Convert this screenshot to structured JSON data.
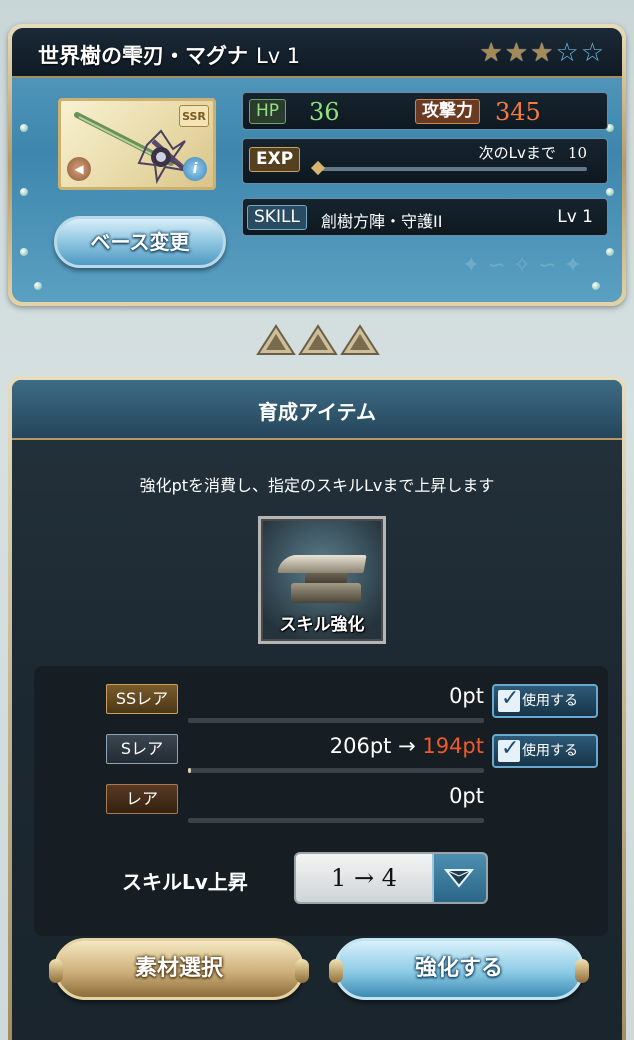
{
  "weapon": {
    "name": "世界樹の雫刃・マグナ",
    "level_label": "Lv 1",
    "rarity": "SSR",
    "stars_filled": 3,
    "stars_total": 5,
    "hp_label": "HP",
    "hp_value": "36",
    "atk_label": "攻撃力",
    "atk_value": "345",
    "exp_label": "EXP",
    "exp_next_label": "次のLvまで",
    "exp_next_value": "10",
    "exp_progress": 0,
    "skill_label": "SKILL",
    "skill_name": "創樹方陣・守護II",
    "skill_level": "Lv 1",
    "base_change_button": "ベース変更"
  },
  "training": {
    "title": "育成アイテム",
    "description": "強化ptを消費し、指定のスキルLvまで上昇します",
    "item_label": "スキル強化",
    "rows": [
      {
        "label": "SSレア",
        "value": "0pt",
        "value_to": "",
        "progress": 0,
        "use_button": "使用する"
      },
      {
        "label": "Sレア",
        "value": "206pt → ",
        "value_to": "194pt",
        "progress": 0.01,
        "use_button": "使用する"
      },
      {
        "label": "レア",
        "value": "0pt",
        "value_to": "",
        "progress": 0,
        "use_button": ""
      }
    ],
    "skill_lv_up_label": "スキルLv上昇",
    "skill_lv_up_value": "1 → 4",
    "material_button": "素材選択",
    "enhance_button": "強化する"
  },
  "colors": {
    "hp": "#8ee37f",
    "atk": "#f57b42",
    "point_after": "#ef5a2c"
  },
  "icons": [
    "sound-icon",
    "info-icon",
    "star-icon",
    "triangle-icon",
    "anvil-icon",
    "check-icon",
    "diamond-dropdown-icon"
  ]
}
